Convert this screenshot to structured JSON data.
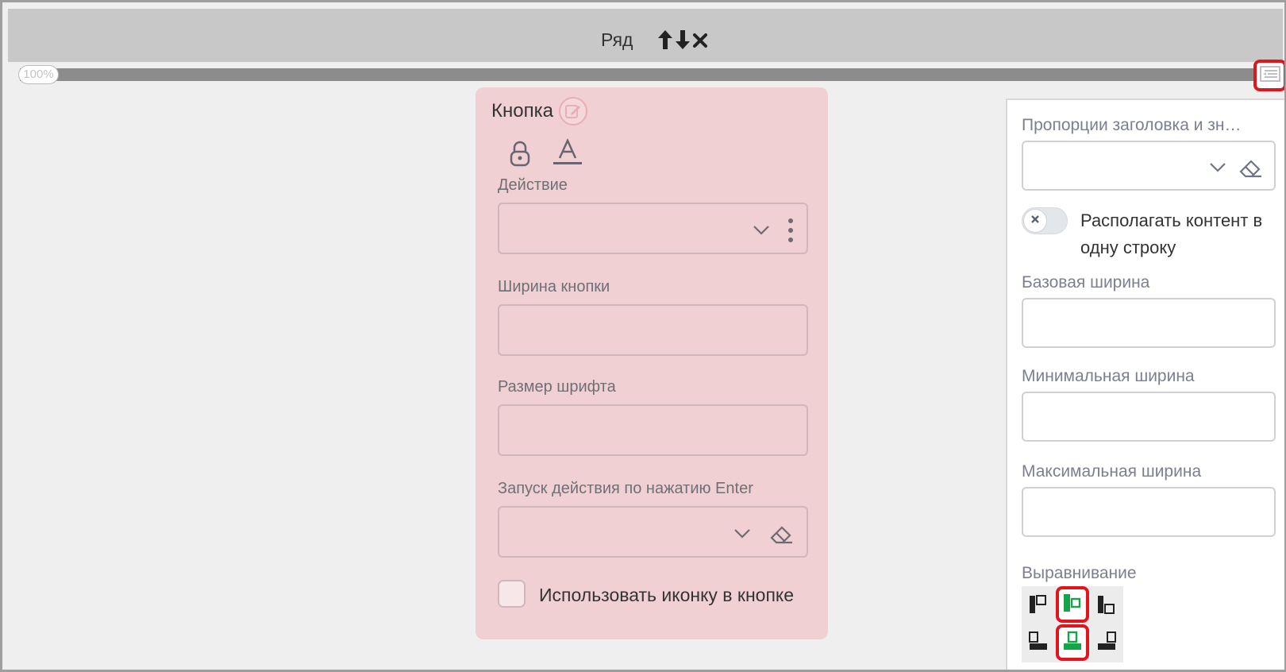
{
  "row": {
    "title": "Ряд",
    "actions": [
      "arrow-up-icon",
      "arrow-down-icon",
      "close-icon"
    ]
  },
  "scale": {
    "label": "100%"
  },
  "button_component": {
    "title": "Кнопка",
    "fields": {
      "action": {
        "label": "Действие",
        "value": ""
      },
      "button_width": {
        "label": "Ширина кнопки",
        "value": ""
      },
      "font_size": {
        "label": "Размер шрифта",
        "value": ""
      },
      "enter_trigger": {
        "label": "Запуск действия по нажатию Enter",
        "value": ""
      }
    },
    "use_icon": {
      "label": "Использовать иконку в кнопке",
      "checked": false
    }
  },
  "right_panel": {
    "proportions": {
      "label": "Пропорции заголовка и зн…",
      "value": ""
    },
    "single_line": {
      "label": "Располагать контент в одну строку",
      "enabled": false
    },
    "base_width": {
      "label": "Базовая ширина",
      "value": ""
    },
    "min_width": {
      "label": "Минимальная ширина",
      "value": ""
    },
    "max_width": {
      "label": "Максимальная ширина",
      "value": ""
    },
    "alignment": {
      "label": "Выравнивание",
      "selected_horizontal": "center",
      "selected_vertical": "center"
    }
  },
  "colors": {
    "highlight": "#e0161f",
    "accent_green": "#17a34a",
    "card_bg": "#f1d0d3"
  }
}
